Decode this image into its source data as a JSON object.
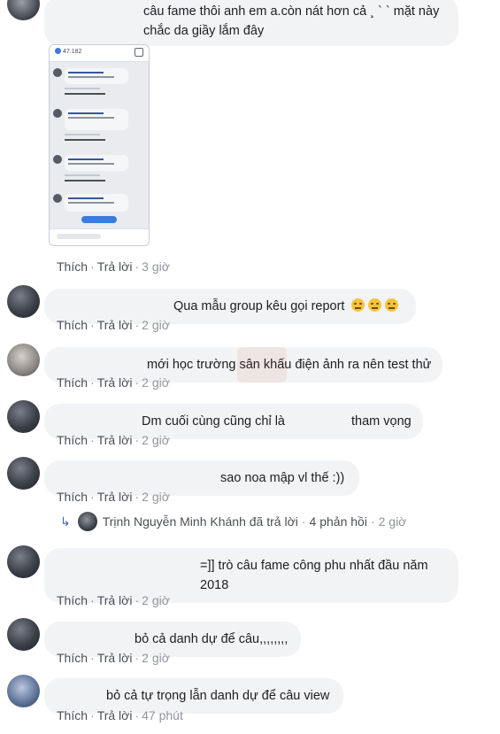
{
  "comments": [
    {
      "text": "câu fame thôi anh em a.còn nát hơn cả ¸ ` ` mặt này chắc da giầy lắm đây",
      "like": "Thích",
      "reply": "Trả lời",
      "time": "3 giờ"
    },
    {
      "text": "Qua mẫu group kêu gọi report",
      "like": "Thích",
      "reply": "Trả lời",
      "time": "2 giờ"
    },
    {
      "text": "mới học trường sân khấu điện ảnh ra nên test thử",
      "like": "Thích",
      "reply": "Trả lời",
      "time": "2 giờ"
    },
    {
      "text_a": "Dm cuối cùng cũng chỉ là",
      "text_b": "tham vọng",
      "like": "Thích",
      "reply": "Trả lời",
      "time": "2 giờ"
    },
    {
      "text": "sao noa mập vl thế :))",
      "like": "Thích",
      "reply": "Trả lời",
      "time": "2 giờ"
    },
    {
      "text": "=]] trò câu fame công phu nhất đầu năm 2018",
      "like": "Thích",
      "reply": "Trả lời",
      "time": "2 giờ"
    },
    {
      "text": "bỏ cả danh dự để câu,,,,,,,,",
      "like": "Thích",
      "reply": "Trả lời",
      "time": "2 giờ"
    },
    {
      "text": "bỏ cả tự trọng lẫn danh dự để câu view",
      "like": "Thích",
      "reply": "Trả lời",
      "time": "47 phút"
    }
  ],
  "reply_summary": {
    "name": "Trịnh Nguyễn Minh Khánh",
    "action": "đã trả lời",
    "count": "4 phản hồi",
    "time": "2 giờ"
  },
  "phone_screenshot": {
    "likes": "47.182"
  },
  "separator": "·"
}
